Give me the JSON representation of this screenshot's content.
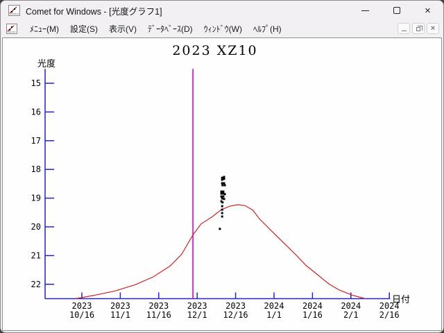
{
  "window": {
    "title": "Comet for Windows - [光度グラフ1]",
    "controls": [
      "minimize",
      "maximize",
      "close"
    ]
  },
  "menu": {
    "items": [
      {
        "label": "ﾒﾆｭｰ(M)"
      },
      {
        "label": "設定(S)"
      },
      {
        "label": "表示(V)"
      },
      {
        "label": "ﾃﾞｰﾀﾍﾞｰｽ(D)"
      },
      {
        "label": "ｳｨﾝﾄﾞｳ(W)"
      },
      {
        "label": "ﾍﾙﾌﾟ(H)"
      }
    ]
  },
  "mdi_controls": [
    "minimize",
    "restore",
    "close"
  ],
  "chart_data": {
    "type": "scatter",
    "title": "2023 XZ10",
    "ylabel": "光度",
    "xlabel": "日付",
    "y_ticks": [
      15,
      16,
      17,
      18,
      19,
      20,
      21,
      22
    ],
    "y_range": [
      14.5,
      22.5
    ],
    "y_axis_note": "magnitude, increases downward",
    "x_tick_labels": [
      [
        "2023",
        "10/16"
      ],
      [
        "2023",
        "11/1"
      ],
      [
        "2023",
        "11/16"
      ],
      [
        "2023",
        "12/1"
      ],
      [
        "2023",
        "12/16"
      ],
      [
        "2024",
        "1/1"
      ],
      [
        "2024",
        "1/16"
      ],
      [
        "2024",
        "2/1"
      ],
      [
        "2024",
        "2/16"
      ]
    ],
    "x_unit": "tick index (0 = 2023 10/16 ... 8 = 2024 2/16)",
    "axis_color": "#2222cc",
    "marker_color": "#d800d8",
    "vertical_marker_x": 2.89,
    "curve": {
      "name": "predicted-light-curve",
      "color": "#cc2222",
      "points": [
        [
          -0.16,
          22.5
        ],
        [
          0.3,
          22.39
        ],
        [
          0.87,
          22.23
        ],
        [
          1.4,
          22.01
        ],
        [
          1.86,
          21.74
        ],
        [
          2.3,
          21.36
        ],
        [
          2.6,
          20.95
        ],
        [
          2.89,
          20.28
        ],
        [
          3.1,
          19.9
        ],
        [
          3.4,
          19.64
        ],
        [
          3.63,
          19.4
        ],
        [
          3.85,
          19.28
        ],
        [
          4.05,
          19.23
        ],
        [
          4.25,
          19.26
        ],
        [
          4.45,
          19.42
        ],
        [
          4.62,
          19.72
        ],
        [
          4.9,
          20.1
        ],
        [
          5.24,
          20.54
        ],
        [
          5.55,
          20.95
        ],
        [
          5.83,
          21.34
        ],
        [
          6.1,
          21.63
        ],
        [
          6.43,
          21.99
        ],
        [
          6.7,
          22.2
        ],
        [
          7.04,
          22.38
        ],
        [
          7.37,
          22.5
        ]
      ]
    },
    "observations": {
      "name": "observed-magnitudes",
      "color": "#000000",
      "points": [
        [
          3.65,
          18.29
        ],
        [
          3.7,
          18.26
        ],
        [
          3.65,
          18.36
        ],
        [
          3.7,
          18.33
        ],
        [
          3.65,
          18.48
        ],
        [
          3.7,
          18.48
        ],
        [
          3.66,
          18.55
        ],
        [
          3.72,
          18.55
        ],
        [
          3.63,
          18.77
        ],
        [
          3.68,
          18.77
        ],
        [
          3.63,
          18.84
        ],
        [
          3.68,
          18.84
        ],
        [
          3.72,
          18.86
        ],
        [
          3.63,
          18.94
        ],
        [
          3.68,
          18.94
        ],
        [
          3.65,
          19.01
        ],
        [
          3.7,
          19.03
        ],
        [
          3.63,
          19.11
        ],
        [
          3.66,
          19.15
        ],
        [
          3.65,
          19.28
        ],
        [
          3.65,
          19.4
        ],
        [
          3.65,
          19.52
        ],
        [
          3.65,
          19.64
        ],
        [
          3.59,
          20.07
        ]
      ]
    }
  }
}
